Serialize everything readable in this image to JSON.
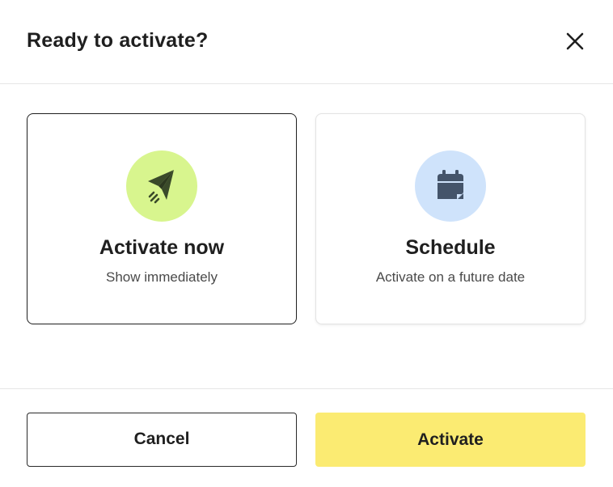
{
  "dialog": {
    "title": "Ready to activate?",
    "close_icon": "close-icon"
  },
  "options": [
    {
      "title": "Activate now",
      "subtitle": "Show immediately",
      "icon": "paper-plane-icon",
      "icon_bg": "#d8f58e",
      "icon_color": "#3a4a2a",
      "selected": true
    },
    {
      "title": "Schedule",
      "subtitle": "Activate on a future date",
      "icon": "calendar-icon",
      "icon_bg": "#cfe3fb",
      "icon_color": "#44546a",
      "selected": false
    }
  ],
  "footer": {
    "cancel_label": "Cancel",
    "activate_label": "Activate",
    "activate_color": "#fbeb72"
  }
}
